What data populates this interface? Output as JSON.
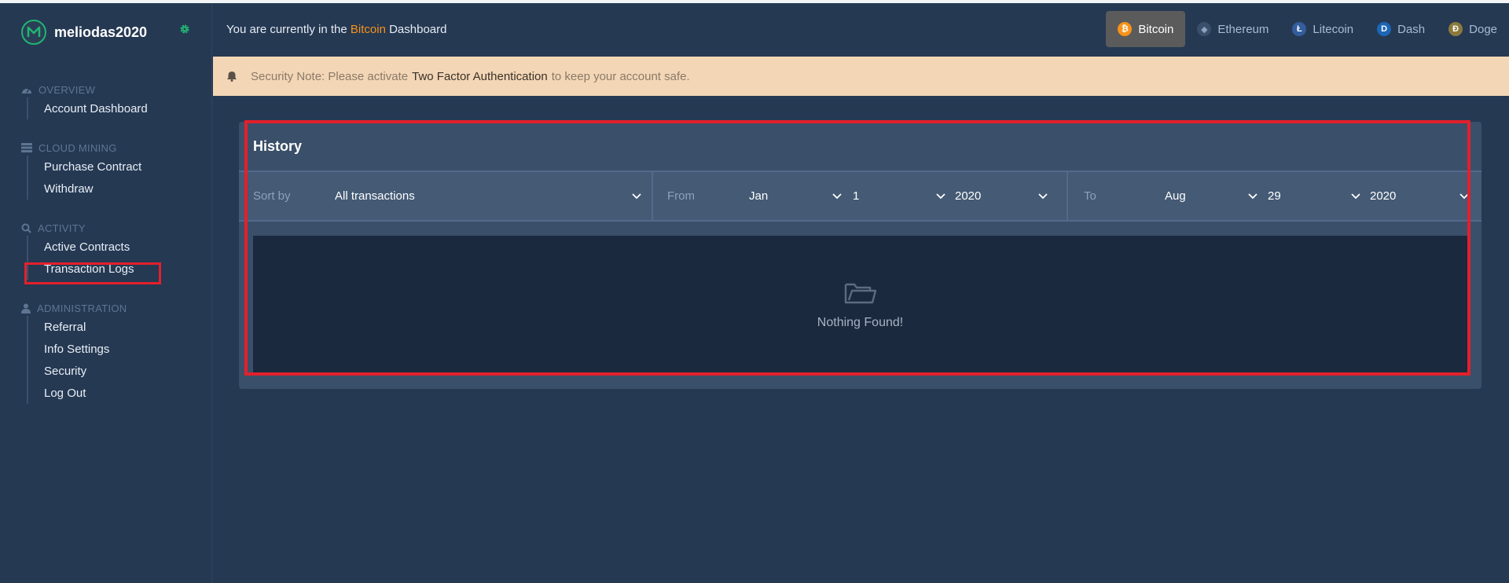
{
  "sidebar": {
    "username": "meliodas2020",
    "sections": [
      {
        "title": "OVERVIEW",
        "icon": "dashboard-icon",
        "items": [
          "Account Dashboard"
        ]
      },
      {
        "title": "CLOUD MINING",
        "icon": "server-icon",
        "items": [
          "Purchase Contract",
          "Withdraw"
        ]
      },
      {
        "title": "ACTIVITY",
        "icon": "search-icon",
        "items": [
          "Active Contracts",
          "Transaction Logs"
        ]
      },
      {
        "title": "ADMINISTRATION",
        "icon": "user-icon",
        "items": [
          "Referral",
          "Info Settings",
          "Security",
          "Log Out"
        ]
      }
    ]
  },
  "topbar": {
    "prefix": "You are currently in the",
    "coin": "Bitcoin",
    "suffix": "Dashboard",
    "coins": [
      {
        "label": "Bitcoin",
        "symbol": "₿",
        "color": "#f7931a",
        "active": true
      },
      {
        "label": "Ethereum",
        "symbol": "◆",
        "color": "#627eea",
        "active": false
      },
      {
        "label": "Litecoin",
        "symbol": "Ł",
        "color": "#345d9d",
        "active": false
      },
      {
        "label": "Dash",
        "symbol": "D",
        "color": "#008ce7",
        "active": false
      },
      {
        "label": "Doge",
        "symbol": "Ð",
        "color": "#c2a633",
        "active": false
      }
    ]
  },
  "notice": {
    "prefix": "Security Note: Please activate",
    "link": "Two Factor Authentication",
    "suffix": "to keep your account safe."
  },
  "history": {
    "title": "History",
    "sort_label": "Sort by",
    "sort_value": "All transactions",
    "from_label": "From",
    "from_month": "Jan",
    "from_day": "1",
    "from_year": "2020",
    "to_label": "To",
    "to_month": "Aug",
    "to_day": "29",
    "to_year": "2020",
    "empty_text": "Nothing Found!"
  },
  "colors": {
    "accent_green": "#21b573",
    "bitcoin_orange": "#f7931a",
    "highlight_red": "#e3202b"
  }
}
